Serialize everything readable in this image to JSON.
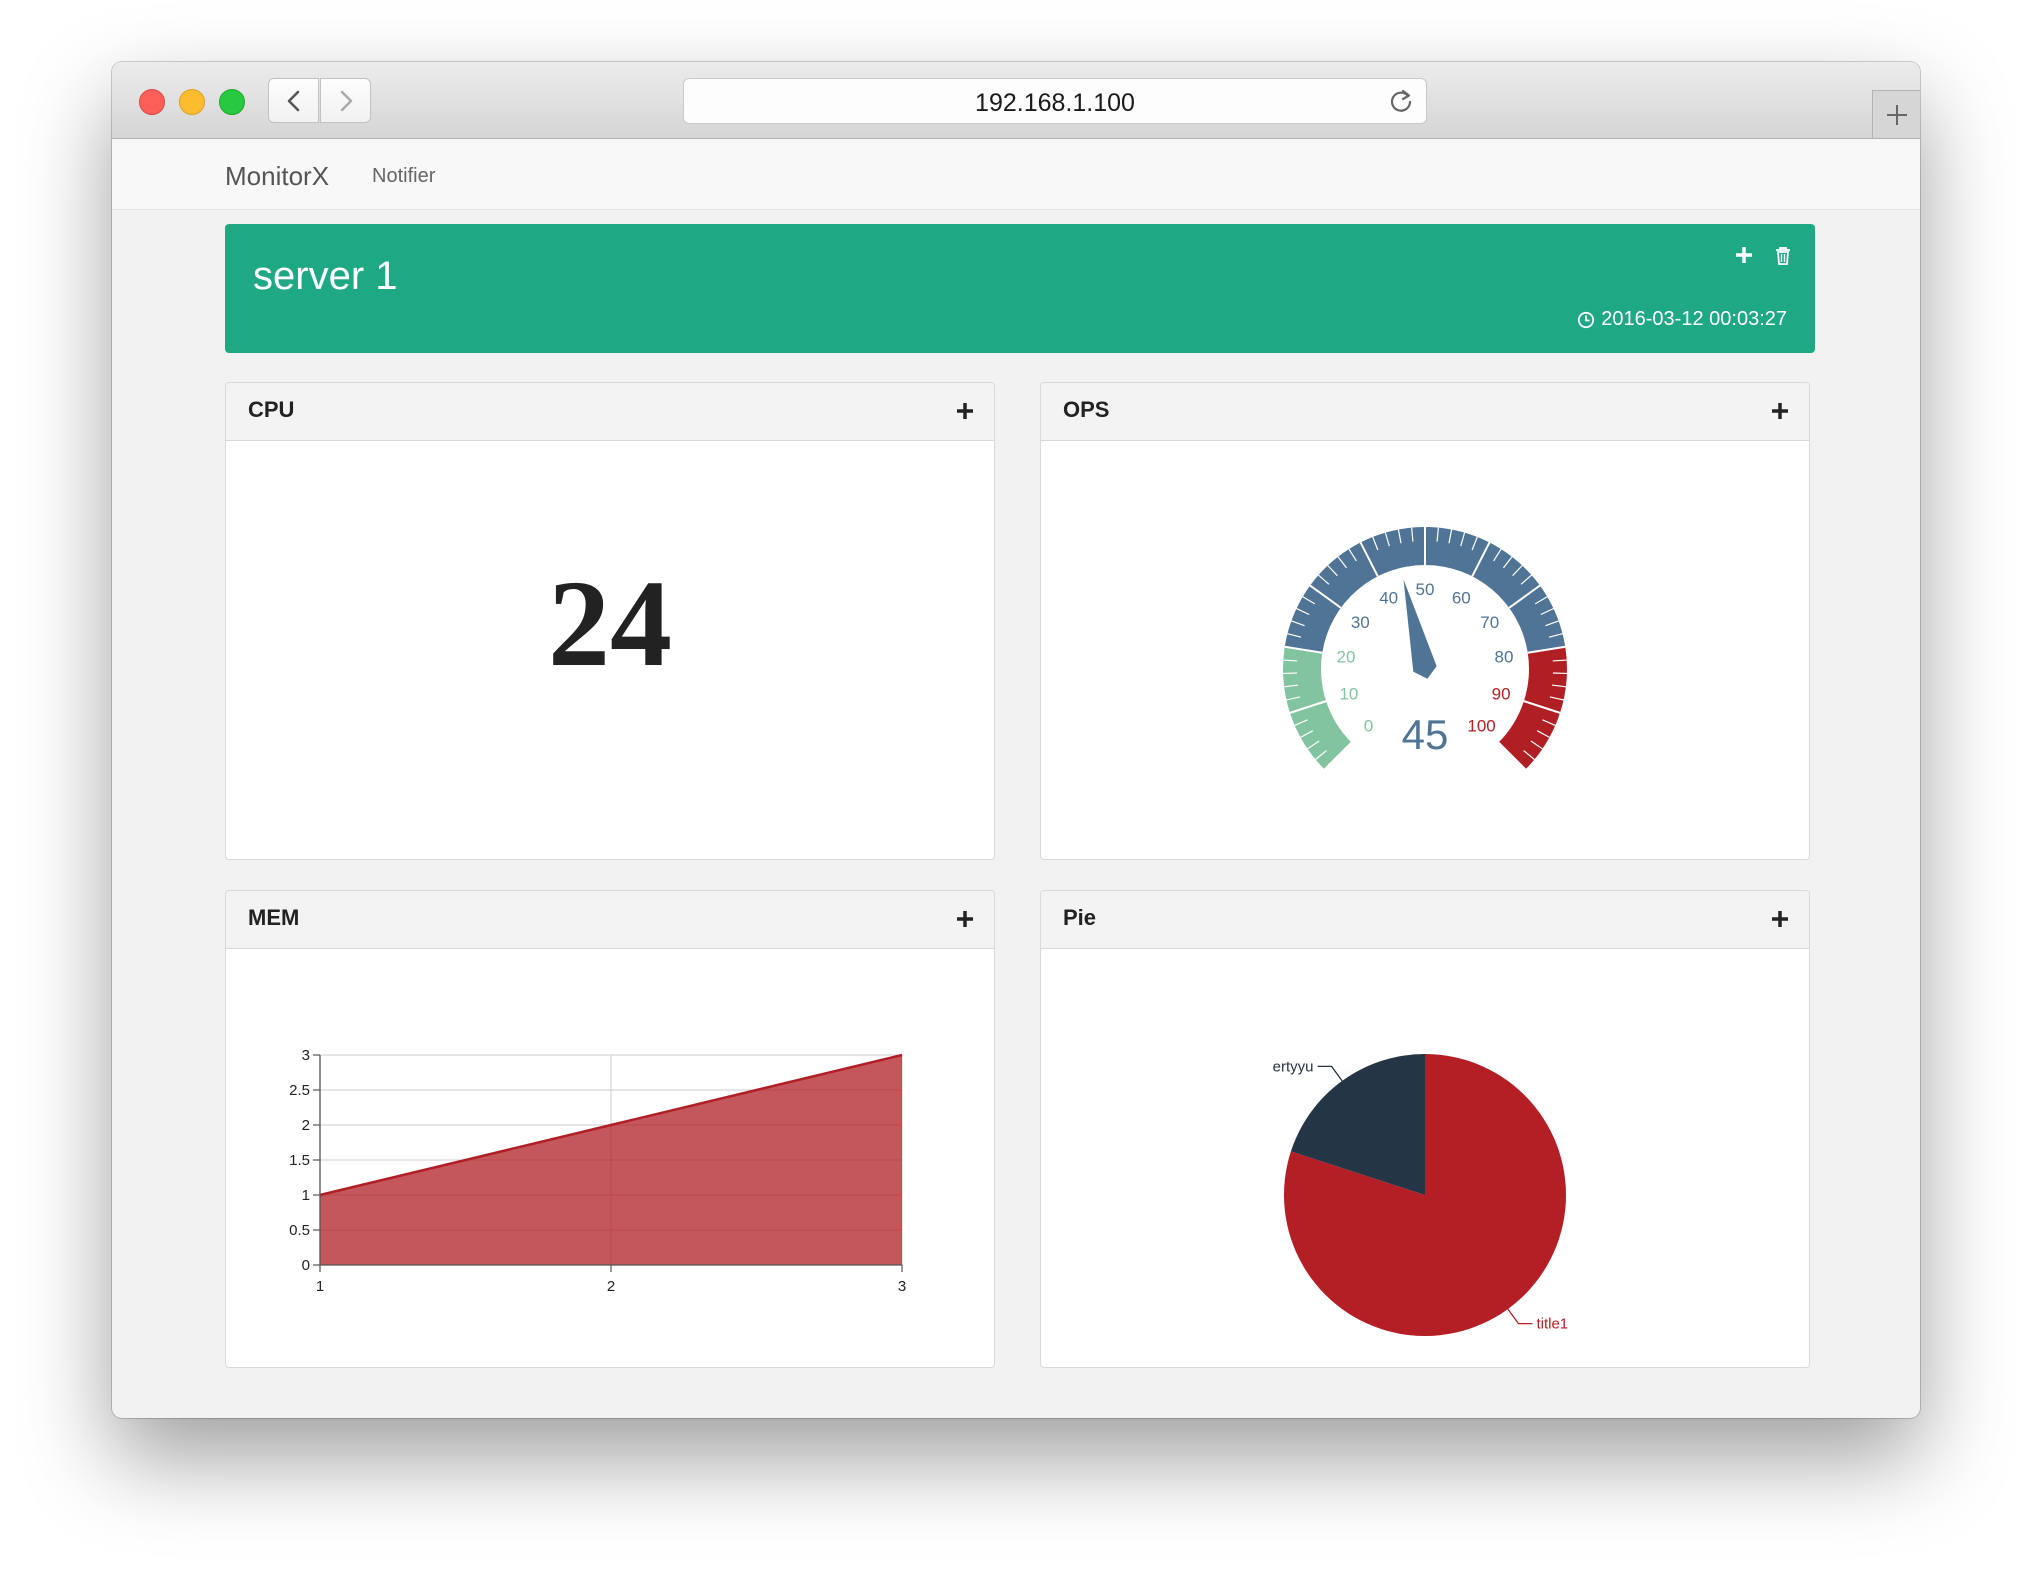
{
  "browser": {
    "url": "192.168.1.100"
  },
  "nav": {
    "brand": "MonitorX",
    "links": [
      "Notifier"
    ]
  },
  "server": {
    "title": "server 1",
    "timestamp": "2016-03-12 00:03:27",
    "color": "#1fa884"
  },
  "panels": {
    "cpu": {
      "title": "CPU",
      "value": "24"
    },
    "ops": {
      "title": "OPS",
      "value": "45"
    },
    "mem": {
      "title": "MEM"
    },
    "pie": {
      "title": "Pie"
    }
  },
  "icons": {
    "back": "chevron-left-icon",
    "forward": "chevron-right-icon",
    "reload": "reload-icon",
    "new_tab": "plus-icon",
    "add": "plus-icon",
    "delete": "trash-icon",
    "clock": "clock-icon"
  },
  "chart_data": [
    {
      "type": "gauge",
      "value": 45,
      "min": 0,
      "max": 100,
      "ticks": [
        "0",
        "10",
        "20",
        "30",
        "40",
        "50",
        "60",
        "70",
        "80",
        "90",
        "100"
      ],
      "bands": [
        {
          "from": 0,
          "to": 20,
          "color": "#82c4a0"
        },
        {
          "from": 20,
          "to": 80,
          "color": "#4f7495"
        },
        {
          "from": 80,
          "to": 100,
          "color": "#b01f24"
        }
      ]
    },
    {
      "type": "area",
      "x": [
        1,
        2,
        3
      ],
      "values": [
        1,
        2,
        3
      ],
      "xticks": [
        "1",
        "2",
        "3"
      ],
      "yticks": [
        "0",
        "0.5",
        "1",
        "1.5",
        "2",
        "2.5",
        "3"
      ],
      "xlim": [
        1,
        3
      ],
      "ylim": [
        0,
        3
      ],
      "grid": true,
      "color": "#b01f24"
    },
    {
      "type": "pie",
      "slices": [
        {
          "label": "title1",
          "value": 80,
          "color": "#b31f24"
        },
        {
          "label": "ertyyu",
          "value": 20,
          "color": "#243545"
        }
      ]
    }
  ]
}
